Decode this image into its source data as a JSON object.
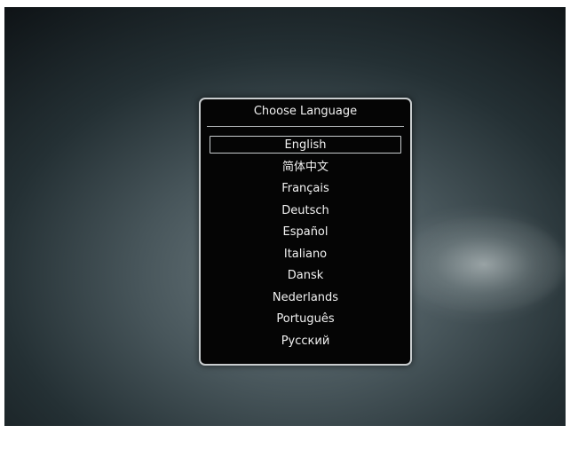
{
  "dialog": {
    "title": "Choose Language",
    "selected_index": 0,
    "languages": [
      "English",
      "简体中文",
      "Français",
      "Deutsch",
      "Español",
      "Italiano",
      "Dansk",
      "Nederlands",
      "Português",
      "Русский"
    ]
  },
  "colors": {
    "dialog_background": "#050505",
    "dialog_border": "#c9cdcf",
    "text": "#f2f2f2"
  }
}
